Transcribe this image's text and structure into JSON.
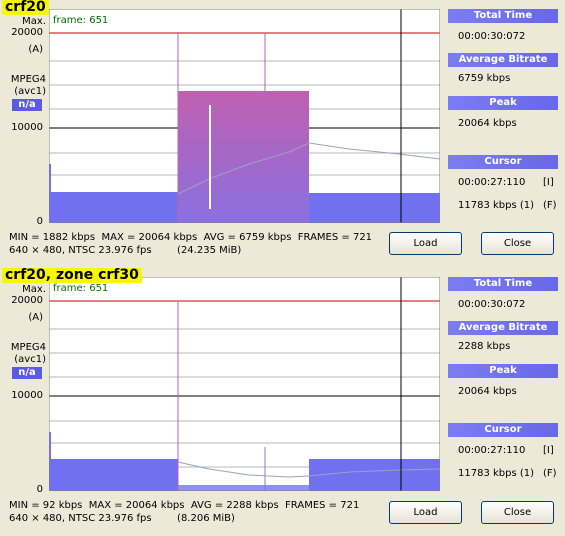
{
  "panels": [
    {
      "tag": "crf20",
      "y_top": "20000",
      "y_mid": "10000",
      "y_zero": "0",
      "max_label": "Max.",
      "a_label": "(A)",
      "codec": "MPEG4",
      "codec_fourcc": "(avc1)",
      "codec_badge": "n/a",
      "frame_label": "frame: 651",
      "side": {
        "total_time_head": "Total Time",
        "total_time": "00:00:30:072",
        "avg_bitrate_head": "Average Bitrate",
        "avg_bitrate": "6759 kbps",
        "peak_head": "Peak",
        "peak": "20064 kbps",
        "cursor_head": "Cursor",
        "cursor_time": "00:00:27:110",
        "cursor_time_flag": "[I]",
        "cursor_rate": "11783 kbps (1)",
        "cursor_rate_flag": "(F)"
      },
      "stats_line1": "MIN = 1882 kbps  MAX = 20064 kbps  AVG = 6759 kbps  FRAMES = 721",
      "stats_line2": "640 × 480, NTSC 23.976 fps        (24.235 MiB)",
      "load_label": "Load",
      "close_label": "Close"
    },
    {
      "tag": "crf20, zone crf30",
      "y_top": "20000",
      "y_mid": "10000",
      "y_zero": "0",
      "max_label": "Max.",
      "a_label": "(A)",
      "codec": "MPEG4",
      "codec_fourcc": "(avc1)",
      "codec_badge": "n/a",
      "frame_label": "frame: 651",
      "side": {
        "total_time_head": "Total Time",
        "total_time": "00:00:30:072",
        "avg_bitrate_head": "Average Bitrate",
        "avg_bitrate": "2288 kbps",
        "peak_head": "Peak",
        "peak": "20064 kbps",
        "cursor_head": "Cursor",
        "cursor_time": "00:00:27:110",
        "cursor_time_flag": "[I]",
        "cursor_rate": "11783 kbps (1)",
        "cursor_rate_flag": "(F)"
      },
      "stats_line1": "MIN = 92 kbps  MAX = 20064 kbps  AVG = 2288 kbps  FRAMES = 721",
      "stats_line2": "640 × 480, NTSC 23.976 fps        (8.206 MiB)",
      "load_label": "Load",
      "close_label": "Close"
    }
  ],
  "colors": {
    "background": "#ece9d8",
    "plot_bg": "#ffffff",
    "bar_blue": "#7070f0",
    "zone_pink": "#c060b0",
    "max_line": "#c00000",
    "header_blue": "#6c6cec",
    "frame_text": "#007000",
    "highlight_tag": "#f7f700"
  }
}
